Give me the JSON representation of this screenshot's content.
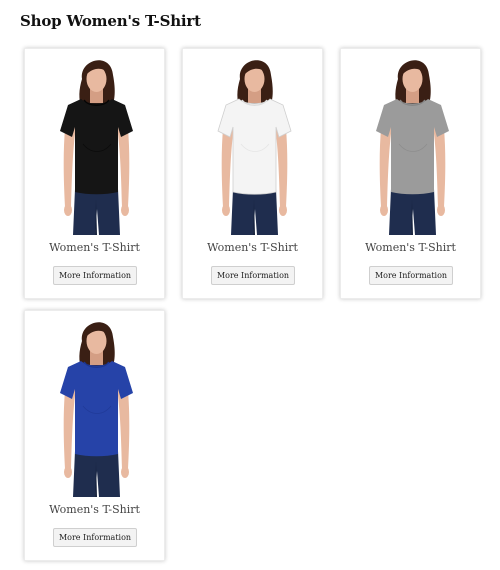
{
  "page": {
    "title": "Shop Women's T-Shirt"
  },
  "products": [
    {
      "name": "Women's T-Shirt",
      "button_label": "More Information",
      "shirt_color": "#151515",
      "shirt_shade": "#050505",
      "image": "model-black-tshirt"
    },
    {
      "name": "Women's T-Shirt",
      "button_label": "More Information",
      "shirt_color": "#f4f4f4",
      "shirt_shade": "#dcdcdc",
      "image": "model-white-tshirt"
    },
    {
      "name": "Women's T-Shirt",
      "button_label": "More Information",
      "shirt_color": "#9b9b9b",
      "shirt_shade": "#858585",
      "image": "model-grey-tshirt"
    },
    {
      "name": "Women's T-Shirt",
      "button_label": "More Information",
      "shirt_color": "#2643a8",
      "shirt_shade": "#1c3590",
      "image": "model-blue-tshirt"
    }
  ]
}
